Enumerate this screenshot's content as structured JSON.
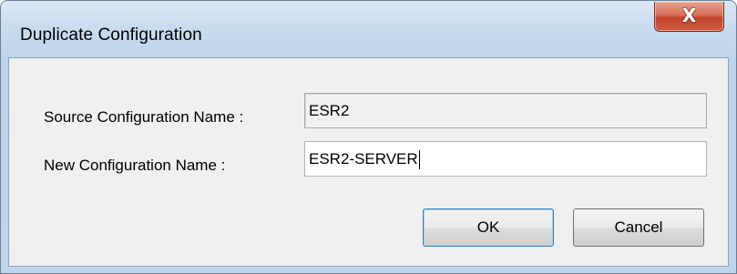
{
  "window": {
    "title": "Duplicate Configuration",
    "close_icon": "close-icon",
    "close_glyph": "X"
  },
  "form": {
    "source_label": "Source Configuration Name :",
    "source_value": "ESR2",
    "new_label": "New Configuration Name :",
    "new_value": "ESR2-SERVER"
  },
  "buttons": {
    "ok_label": "OK",
    "cancel_label": "Cancel"
  },
  "colors": {
    "title_bar": "#c8dcef",
    "close_button": "#c4432c",
    "client_background": "#f0f0f0"
  }
}
